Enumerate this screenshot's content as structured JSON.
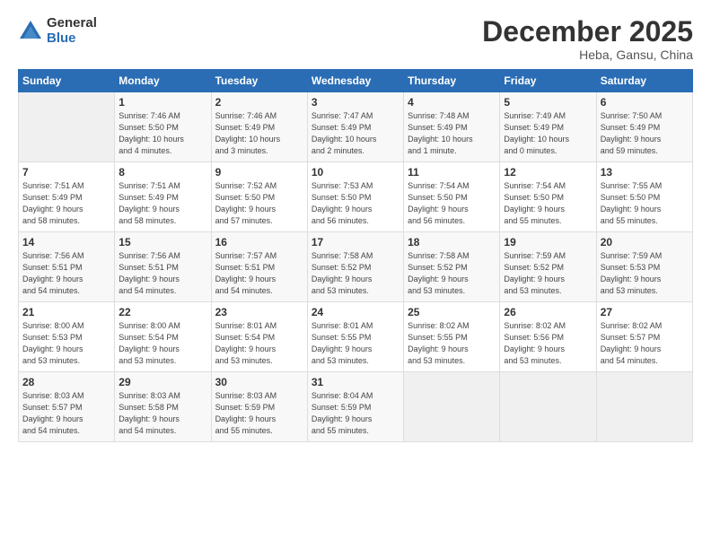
{
  "header": {
    "logo_general": "General",
    "logo_blue": "Blue",
    "month_title": "December 2025",
    "location": "Heba, Gansu, China"
  },
  "days_of_week": [
    "Sunday",
    "Monday",
    "Tuesday",
    "Wednesday",
    "Thursday",
    "Friday",
    "Saturday"
  ],
  "weeks": [
    [
      {
        "day": "",
        "info": ""
      },
      {
        "day": "1",
        "info": "Sunrise: 7:46 AM\nSunset: 5:50 PM\nDaylight: 10 hours\nand 4 minutes."
      },
      {
        "day": "2",
        "info": "Sunrise: 7:46 AM\nSunset: 5:49 PM\nDaylight: 10 hours\nand 3 minutes."
      },
      {
        "day": "3",
        "info": "Sunrise: 7:47 AM\nSunset: 5:49 PM\nDaylight: 10 hours\nand 2 minutes."
      },
      {
        "day": "4",
        "info": "Sunrise: 7:48 AM\nSunset: 5:49 PM\nDaylight: 10 hours\nand 1 minute."
      },
      {
        "day": "5",
        "info": "Sunrise: 7:49 AM\nSunset: 5:49 PM\nDaylight: 10 hours\nand 0 minutes."
      },
      {
        "day": "6",
        "info": "Sunrise: 7:50 AM\nSunset: 5:49 PM\nDaylight: 9 hours\nand 59 minutes."
      }
    ],
    [
      {
        "day": "7",
        "info": "Sunrise: 7:51 AM\nSunset: 5:49 PM\nDaylight: 9 hours\nand 58 minutes."
      },
      {
        "day": "8",
        "info": "Sunrise: 7:51 AM\nSunset: 5:49 PM\nDaylight: 9 hours\nand 58 minutes."
      },
      {
        "day": "9",
        "info": "Sunrise: 7:52 AM\nSunset: 5:50 PM\nDaylight: 9 hours\nand 57 minutes."
      },
      {
        "day": "10",
        "info": "Sunrise: 7:53 AM\nSunset: 5:50 PM\nDaylight: 9 hours\nand 56 minutes."
      },
      {
        "day": "11",
        "info": "Sunrise: 7:54 AM\nSunset: 5:50 PM\nDaylight: 9 hours\nand 56 minutes."
      },
      {
        "day": "12",
        "info": "Sunrise: 7:54 AM\nSunset: 5:50 PM\nDaylight: 9 hours\nand 55 minutes."
      },
      {
        "day": "13",
        "info": "Sunrise: 7:55 AM\nSunset: 5:50 PM\nDaylight: 9 hours\nand 55 minutes."
      }
    ],
    [
      {
        "day": "14",
        "info": "Sunrise: 7:56 AM\nSunset: 5:51 PM\nDaylight: 9 hours\nand 54 minutes."
      },
      {
        "day": "15",
        "info": "Sunrise: 7:56 AM\nSunset: 5:51 PM\nDaylight: 9 hours\nand 54 minutes."
      },
      {
        "day": "16",
        "info": "Sunrise: 7:57 AM\nSunset: 5:51 PM\nDaylight: 9 hours\nand 54 minutes."
      },
      {
        "day": "17",
        "info": "Sunrise: 7:58 AM\nSunset: 5:52 PM\nDaylight: 9 hours\nand 53 minutes."
      },
      {
        "day": "18",
        "info": "Sunrise: 7:58 AM\nSunset: 5:52 PM\nDaylight: 9 hours\nand 53 minutes."
      },
      {
        "day": "19",
        "info": "Sunrise: 7:59 AM\nSunset: 5:52 PM\nDaylight: 9 hours\nand 53 minutes."
      },
      {
        "day": "20",
        "info": "Sunrise: 7:59 AM\nSunset: 5:53 PM\nDaylight: 9 hours\nand 53 minutes."
      }
    ],
    [
      {
        "day": "21",
        "info": "Sunrise: 8:00 AM\nSunset: 5:53 PM\nDaylight: 9 hours\nand 53 minutes."
      },
      {
        "day": "22",
        "info": "Sunrise: 8:00 AM\nSunset: 5:54 PM\nDaylight: 9 hours\nand 53 minutes."
      },
      {
        "day": "23",
        "info": "Sunrise: 8:01 AM\nSunset: 5:54 PM\nDaylight: 9 hours\nand 53 minutes."
      },
      {
        "day": "24",
        "info": "Sunrise: 8:01 AM\nSunset: 5:55 PM\nDaylight: 9 hours\nand 53 minutes."
      },
      {
        "day": "25",
        "info": "Sunrise: 8:02 AM\nSunset: 5:55 PM\nDaylight: 9 hours\nand 53 minutes."
      },
      {
        "day": "26",
        "info": "Sunrise: 8:02 AM\nSunset: 5:56 PM\nDaylight: 9 hours\nand 53 minutes."
      },
      {
        "day": "27",
        "info": "Sunrise: 8:02 AM\nSunset: 5:57 PM\nDaylight: 9 hours\nand 54 minutes."
      }
    ],
    [
      {
        "day": "28",
        "info": "Sunrise: 8:03 AM\nSunset: 5:57 PM\nDaylight: 9 hours\nand 54 minutes."
      },
      {
        "day": "29",
        "info": "Sunrise: 8:03 AM\nSunset: 5:58 PM\nDaylight: 9 hours\nand 54 minutes."
      },
      {
        "day": "30",
        "info": "Sunrise: 8:03 AM\nSunset: 5:59 PM\nDaylight: 9 hours\nand 55 minutes."
      },
      {
        "day": "31",
        "info": "Sunrise: 8:04 AM\nSunset: 5:59 PM\nDaylight: 9 hours\nand 55 minutes."
      },
      {
        "day": "",
        "info": ""
      },
      {
        "day": "",
        "info": ""
      },
      {
        "day": "",
        "info": ""
      }
    ]
  ]
}
